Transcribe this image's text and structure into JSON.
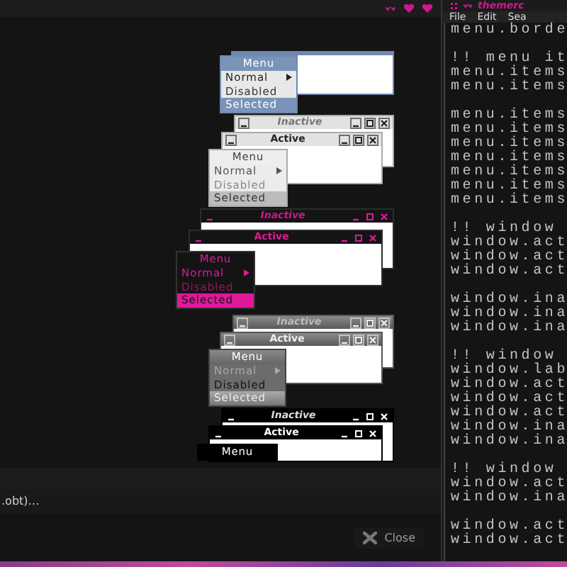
{
  "themes": [
    {
      "kind": "blue",
      "menu": {
        "title": "Menu",
        "items": [
          {
            "label": "Normal",
            "submenu": true,
            "disabled": false,
            "selected": false
          },
          {
            "label": "Disabled",
            "submenu": false,
            "disabled": true,
            "selected": false
          },
          {
            "label": "Selected",
            "submenu": false,
            "disabled": false,
            "selected": true
          }
        ]
      }
    },
    {
      "kind": "grey",
      "inactive_title": "Inactive",
      "active_title": "Active",
      "menu": {
        "title": "Menu",
        "items": [
          {
            "label": "Normal",
            "submenu": true,
            "disabled": false,
            "selected": false
          },
          {
            "label": "Disabled",
            "submenu": false,
            "disabled": true,
            "selected": false
          },
          {
            "label": "Selected",
            "submenu": false,
            "disabled": false,
            "selected": true
          }
        ]
      }
    },
    {
      "kind": "pink",
      "inactive_title": "Inactive",
      "active_title": "Active",
      "menu": {
        "title": "Menu",
        "items": [
          {
            "label": "Normal",
            "submenu": true,
            "disabled": false,
            "selected": false
          },
          {
            "label": "Disabled",
            "submenu": false,
            "disabled": true,
            "selected": false
          },
          {
            "label": "Selected",
            "submenu": false,
            "disabled": false,
            "selected": true
          }
        ]
      }
    },
    {
      "kind": "metal",
      "inactive_title": "Inactive",
      "active_title": "Active",
      "menu": {
        "title": "Menu",
        "items": [
          {
            "label": "Normal",
            "submenu": true,
            "disabled": false,
            "selected": false
          },
          {
            "label": "Disabled",
            "submenu": false,
            "disabled": true,
            "selected": false
          },
          {
            "label": "Selected",
            "submenu": false,
            "disabled": false,
            "selected": true
          }
        ]
      }
    },
    {
      "kind": "black",
      "inactive_title": "Inactive",
      "active_title": "Active",
      "menu": {
        "title": "Menu"
      }
    }
  ],
  "file_row": {
    "text": ".obt)…"
  },
  "close_button": {
    "label": "Close"
  },
  "editor": {
    "title": "themerc",
    "menu": [
      "File",
      "Edit",
      "Sea"
    ],
    "blocks": [
      [
        "menu.borde"
      ],
      [
        "!! menu it",
        "menu.items",
        "menu.items"
      ],
      [
        "menu.items",
        "menu.items",
        "menu.items",
        "menu.items",
        "menu.items",
        "menu.items",
        "menu.items"
      ],
      [
        "!! window",
        "window.act",
        "window.act",
        "window.act"
      ],
      [
        "window.ina",
        "window.ina",
        "window.ina"
      ],
      [
        "!! window",
        "window.lab",
        "window.act",
        "window.act",
        "window.act",
        "window.ina",
        "window.ina"
      ],
      [
        "!! window",
        "window.act",
        "window.ina"
      ],
      [
        "window.act",
        "window.act"
      ]
    ]
  }
}
